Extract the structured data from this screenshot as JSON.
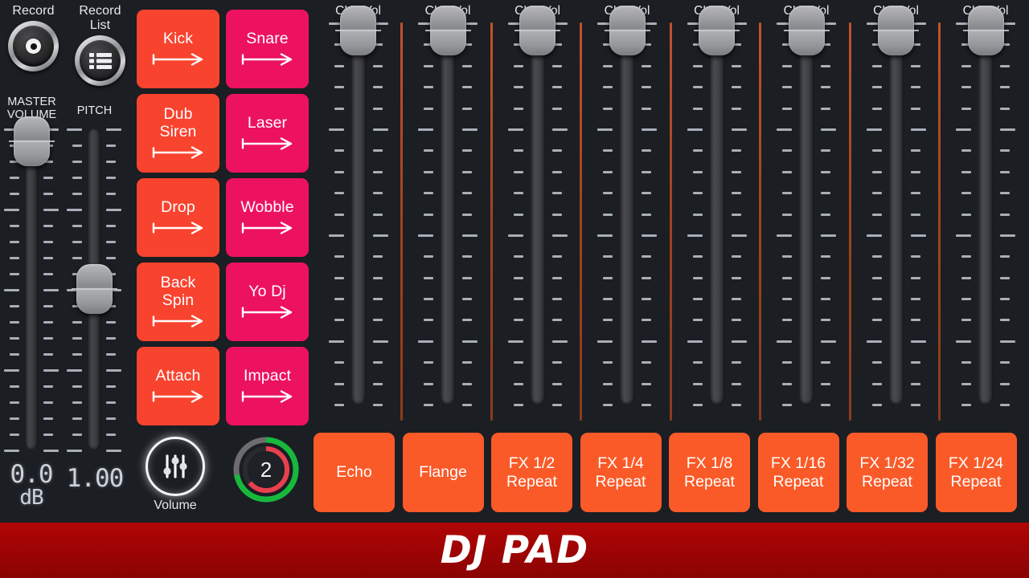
{
  "app": {
    "banner_title": "DJ PAD",
    "banner_color": "#9c0404",
    "background_color": "#1b1e23"
  },
  "left_panel": {
    "record_button": {
      "caption": "Record",
      "icon": "record-dot-icon"
    },
    "record_list_button": {
      "caption": "Record\nList",
      "icon": "list-icon"
    },
    "master": {
      "title": "MASTER\nVOLUME",
      "value": "0.0",
      "unit": "dB",
      "knob_position_pct": 4,
      "tick_count": 21
    },
    "pitch": {
      "title": "PITCH",
      "value": "1.00",
      "knob_position_pct": 50,
      "tick_count": 21
    }
  },
  "pads": [
    {
      "label": "Kick",
      "color": "orange",
      "arrow": "arrow-right-icon"
    },
    {
      "label": "Snare",
      "color": "pink",
      "arrow": "arrow-right-icon"
    },
    {
      "label": "Dub\nSiren",
      "color": "orange",
      "arrow": "arrow-right-icon"
    },
    {
      "label": "Laser",
      "color": "pink",
      "arrow": "arrow-right-icon"
    },
    {
      "label": "Drop",
      "color": "orange",
      "arrow": "arrow-right-icon"
    },
    {
      "label": "Wobble",
      "color": "pink",
      "arrow": "arrow-right-icon"
    },
    {
      "label": "Back\nSpin",
      "color": "orange",
      "arrow": "arrow-right-icon"
    },
    {
      "label": "Yo Dj",
      "color": "pink",
      "arrow": "arrow-right-icon"
    },
    {
      "label": "Attach",
      "color": "orange",
      "arrow": "arrow-right-icon"
    },
    {
      "label": "Impact",
      "color": "pink",
      "arrow": "arrow-right-icon"
    }
  ],
  "pad_colors": {
    "orange": "#f8432f",
    "pink": "#ec1260"
  },
  "volume_icon": {
    "caption": "Volume",
    "icon": "mixer-sliders-icon"
  },
  "ring_indicator": {
    "value": "2",
    "outer_arc_color": "#17b93c",
    "outer_track_color": "#6d6d70",
    "outer_sweep_pct": 72,
    "inner_arc_color": "#e8404f",
    "inner_sweep_pct": 64
  },
  "channels": [
    {
      "label": "CH1 Vol",
      "knob_position_pct": 2
    },
    {
      "label": "CH2 Vol",
      "knob_position_pct": 2
    },
    {
      "label": "CH3 Vol",
      "knob_position_pct": 2
    },
    {
      "label": "CH4 Vol",
      "knob_position_pct": 2
    },
    {
      "label": "CH5 Vol",
      "knob_position_pct": 2
    },
    {
      "label": "CH6 Vol",
      "knob_position_pct": 2
    },
    {
      "label": "CH7 Vol",
      "knob_position_pct": 2
    },
    {
      "label": "CH8 Vol",
      "knob_position_pct": 2
    }
  ],
  "fx_buttons": [
    {
      "label": "Echo"
    },
    {
      "label": "Flange"
    },
    {
      "label": "FX 1/2\nRepeat"
    },
    {
      "label": "FX 1/4\nRepeat"
    },
    {
      "label": "FX 1/8\nRepeat"
    },
    {
      "label": "FX 1/16\nRepeat"
    },
    {
      "label": "FX 1/32\nRepeat"
    },
    {
      "label": "FX 1/24\nRepeat"
    }
  ],
  "fx_color": "#fa5a28"
}
